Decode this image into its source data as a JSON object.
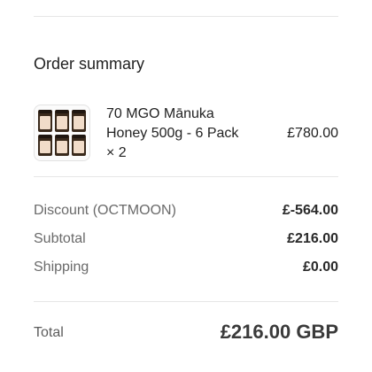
{
  "summary": {
    "heading": "Order summary"
  },
  "product": {
    "name": "70 MGO Mānuka Honey 500g - 6 Pack × 2",
    "price": "£780.00",
    "thumbnail_icon": "honey-jars-image"
  },
  "lines": {
    "discount_label": "Discount (OCTMOON)",
    "discount_value": "£-564.00",
    "subtotal_label": "Subtotal",
    "subtotal_value": "£216.00",
    "shipping_label": "Shipping",
    "shipping_value": "£0.00"
  },
  "total": {
    "label": "Total",
    "value": "£216.00 GBP"
  }
}
